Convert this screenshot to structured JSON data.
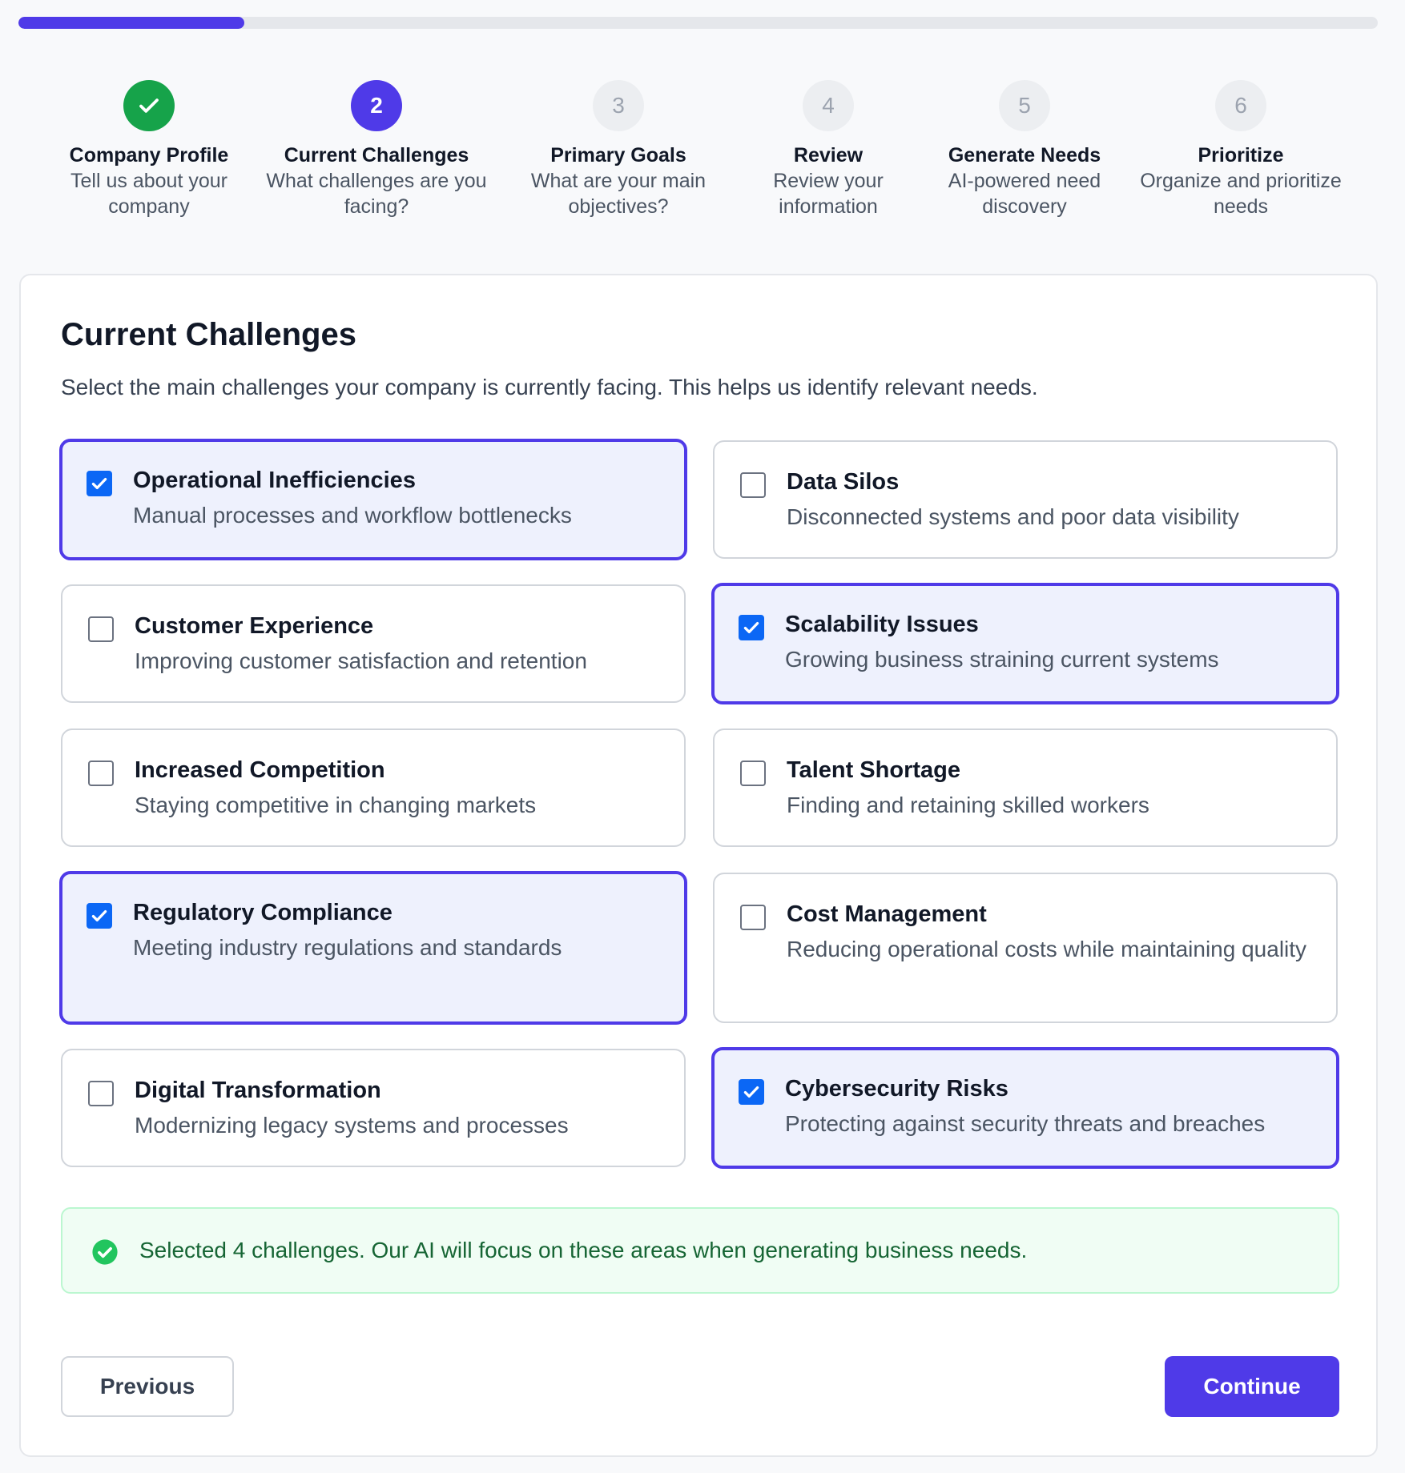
{
  "progress": {
    "value": 0.166
  },
  "steps": [
    {
      "number": "✓",
      "title": "Company Profile",
      "description": "Tell us about your company",
      "state": "done"
    },
    {
      "number": "2",
      "title": "Current Challenges",
      "description": "What challenges are you facing?",
      "state": "current"
    },
    {
      "number": "3",
      "title": "Primary Goals",
      "description": "What are your main objectives?",
      "state": "todo"
    },
    {
      "number": "4",
      "title": "Review",
      "description": "Review your information",
      "state": "todo"
    },
    {
      "number": "5",
      "title": "Generate Needs",
      "description": "AI-powered need discovery",
      "state": "todo"
    },
    {
      "number": "6",
      "title": "Prioritize",
      "description": "Organize and prioritize needs",
      "state": "todo"
    }
  ],
  "main": {
    "title": "Current Challenges",
    "subtitle": "Select the main challenges your company is currently facing. This helps us identify relevant needs.",
    "options": [
      {
        "title": "Operational Inefficiencies",
        "description": "Manual processes and workflow bottlenecks",
        "checked": true
      },
      {
        "title": "Data Silos",
        "description": "Disconnected systems and poor data visibility",
        "checked": false
      },
      {
        "title": "Customer Experience",
        "description": "Improving customer satisfaction and retention",
        "checked": false
      },
      {
        "title": "Scalability Issues",
        "description": "Growing business straining current systems",
        "checked": true
      },
      {
        "title": "Increased Competition",
        "description": "Staying competitive in changing markets",
        "checked": false
      },
      {
        "title": "Talent Shortage",
        "description": "Finding and retaining skilled workers",
        "checked": false
      },
      {
        "title": "Regulatory Compliance",
        "description": "Meeting industry regulations and standards",
        "checked": true
      },
      {
        "title": "Cost Management",
        "description": "Reducing operational costs while maintaining quality",
        "checked": false
      },
      {
        "title": "Digital Transformation",
        "description": "Modernizing legacy systems and processes",
        "checked": false
      },
      {
        "title": "Cybersecurity Risks",
        "description": "Protecting against security threats and breaches",
        "checked": true
      }
    ],
    "notice": "Selected 4 challenges. Our AI will focus on these areas when generating business needs."
  },
  "footer": {
    "previous_label": "Previous",
    "continue_label": "Continue"
  },
  "colors": {
    "accent": "#4f3ae8",
    "success": "#16a34a",
    "checkbox": "#0b67f5"
  },
  "icons": {
    "step_done": "check-icon",
    "notice": "check-circle-icon"
  }
}
